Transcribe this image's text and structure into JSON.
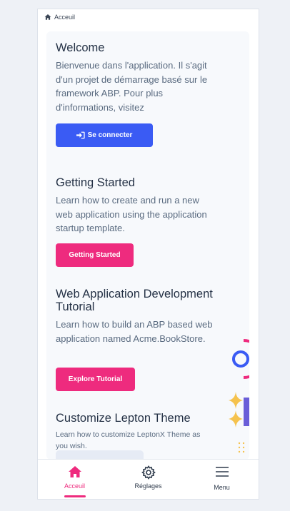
{
  "breadcrumb": {
    "label": "Acceuil"
  },
  "welcome": {
    "title": "Welcome",
    "description": "Bienvenue dans l'application. Il s'agit d'un projet de démarrage basé sur le framework ABP. Pour plus d'informations, visitez",
    "login_label": "Se connecter"
  },
  "getting_started": {
    "title": "Getting Started",
    "description": "Learn how to create and run a new web application using the application startup template.",
    "button_label": "Getting Started"
  },
  "tutorial": {
    "title": "Web Application Development Tutorial",
    "description": "Learn how to build an ABP based web application named Acme.BookStore.",
    "button_label": "Explore Tutorial"
  },
  "customize": {
    "title": "Customize Lepton Theme",
    "description": "Learn how to customize LeptonX Theme as you wish."
  },
  "nav": {
    "items": [
      {
        "label": "Acceuil",
        "icon": "home-icon",
        "active": true
      },
      {
        "label": "Réglages",
        "icon": "gear-icon",
        "active": false
      },
      {
        "label": "Menu",
        "icon": "hamburger-icon",
        "active": false
      }
    ]
  },
  "colors": {
    "primary": "#3a5bf4",
    "accent": "#ee2b7e",
    "star": "#f5c24d",
    "violet": "#6a5ed8"
  }
}
